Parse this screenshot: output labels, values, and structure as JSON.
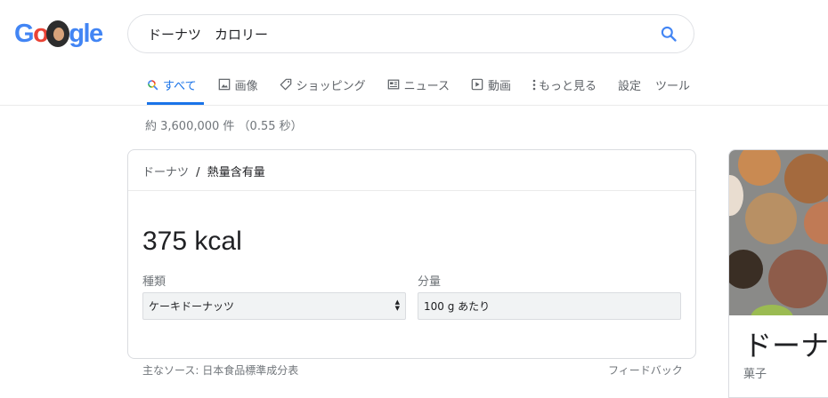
{
  "logo": {
    "letters": [
      "G",
      "o",
      "gle"
    ]
  },
  "search": {
    "query": "ドーナツ　カロリー"
  },
  "tabs": [
    {
      "label": "すべて",
      "icon": "search-icon"
    },
    {
      "label": "画像",
      "icon": "image-icon"
    },
    {
      "label": "ショッピング",
      "icon": "tag-icon"
    },
    {
      "label": "ニュース",
      "icon": "news-icon"
    },
    {
      "label": "動画",
      "icon": "video-icon"
    },
    {
      "label": "もっと見る",
      "icon": "more-vert-icon"
    },
    {
      "label": "設定"
    },
    {
      "label": "ツール"
    }
  ],
  "stats": "約 3,600,000 件 （0.55 秒）",
  "card": {
    "breadcrumb_parent": "ドーナツ",
    "breadcrumb_sep": "/",
    "breadcrumb_current": "熱量含有量",
    "value": "375 kcal",
    "type_label": "種類",
    "type_value": "ケーキドーナッツ",
    "amount_label": "分量",
    "amount_value": "100 g あたり"
  },
  "footer": {
    "source": "主なソース: 日本食品標準成分表",
    "feedback": "フィードバック"
  },
  "panel": {
    "title": "ドーナツ",
    "subtitle": "菓子"
  },
  "colors": {
    "accent": "#1a73e8",
    "text": "#202124",
    "muted": "#70757a"
  }
}
